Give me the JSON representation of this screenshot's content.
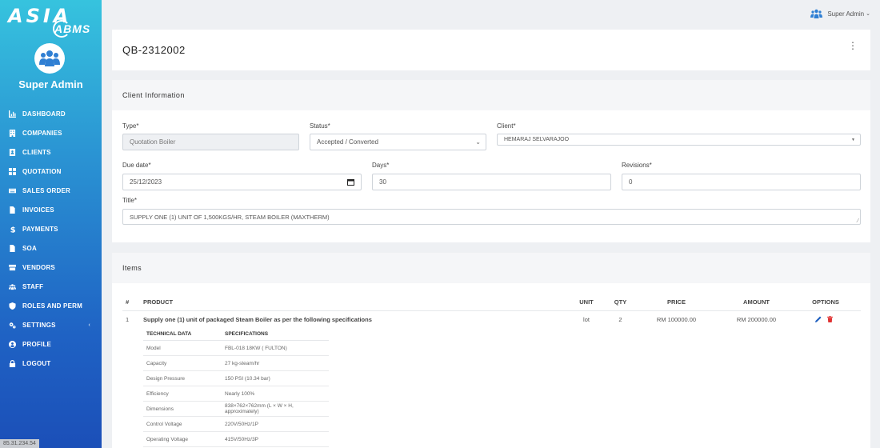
{
  "brand": {
    "logo_main": "ASIA",
    "logo_sub": "ABMS"
  },
  "sidebar": {
    "user": "Super Admin",
    "items": [
      {
        "label": "DASHBOARD",
        "icon": "chart-icon"
      },
      {
        "label": "COMPANIES",
        "icon": "building-icon"
      },
      {
        "label": "CLIENTS",
        "icon": "contact-card-icon"
      },
      {
        "label": "QUOTATION",
        "icon": "grid-icon"
      },
      {
        "label": "SALES ORDER",
        "icon": "keyboard-icon"
      },
      {
        "label": "INVOICES",
        "icon": "file-icon"
      },
      {
        "label": "PAYMENTS",
        "icon": "dollar-icon"
      },
      {
        "label": "SOA",
        "icon": "file-icon"
      },
      {
        "label": "VENDORS",
        "icon": "archive-icon"
      },
      {
        "label": "STAFF",
        "icon": "users-icon"
      },
      {
        "label": "ROLES AND PERM",
        "icon": "shield-icon"
      },
      {
        "label": "SETTINGS",
        "icon": "gears-icon"
      },
      {
        "label": "PROFILE",
        "icon": "user-circle-icon"
      },
      {
        "label": "LOGOUT",
        "icon": "lock-icon"
      }
    ],
    "ip": "85.31.234.54"
  },
  "topbar": {
    "user_label": "Super Admin"
  },
  "quotation": {
    "number": "QB-2312002"
  },
  "client_info": {
    "heading": "Client Information",
    "type_label": "Type*",
    "type_value": "Quotation Boiler",
    "status_label": "Status*",
    "status_value": "Accepted / Converted",
    "client_label": "Client*",
    "client_value": "HEMARAJ SELVARAJOO",
    "due_label": "Due date*",
    "due_value": "25/12/2023",
    "days_label": "Days*",
    "days_value": "30",
    "revisions_label": "Revisions*",
    "revisions_value": "0",
    "title_label": "Title*",
    "title_value": "SUPPLY  ONE (1) UNIT OF 1,500KGS/HR, STEAM BOILER (MAXTHERM)"
  },
  "items": {
    "heading": "Items",
    "columns": {
      "num": "#",
      "product": "PRODUCT",
      "unit": "UNIT",
      "qty": "QTY",
      "price": "PRICE",
      "amount": "AMOUNT",
      "options": "OPTIONS"
    },
    "rows": [
      {
        "num": "1",
        "product": "Supply one (1) unit of packaged Steam Boiler as per the following specifications",
        "unit": "lot",
        "qty": "2",
        "price": "RM 100000.00",
        "amount": "RM 200000.00",
        "spec_headers": [
          "TECHNICAL DATA",
          "SPECIFICATIONS"
        ],
        "specs": [
          [
            "Model",
            "FBL-018 18KW ( FULTON)"
          ],
          [
            "Capacity",
            "27 kg-steam/hr"
          ],
          [
            "Design Pressure",
            "150 PSI (10.34 bar)"
          ],
          [
            "Efficiency",
            "Nearly 100%"
          ],
          [
            "Dimensions",
            "838×762×762mm (L × W × H, approximately)"
          ],
          [
            "Control Voltage",
            "220V/50Hz/1P"
          ],
          [
            "Operating Voltage",
            "415V/50Hz/3P"
          ]
        ]
      }
    ]
  },
  "colors": {
    "sidebar_top": "#36c3de",
    "sidebar_bottom": "#1b4fb8",
    "edit": "#1f5fbf",
    "delete": "#e03131"
  }
}
